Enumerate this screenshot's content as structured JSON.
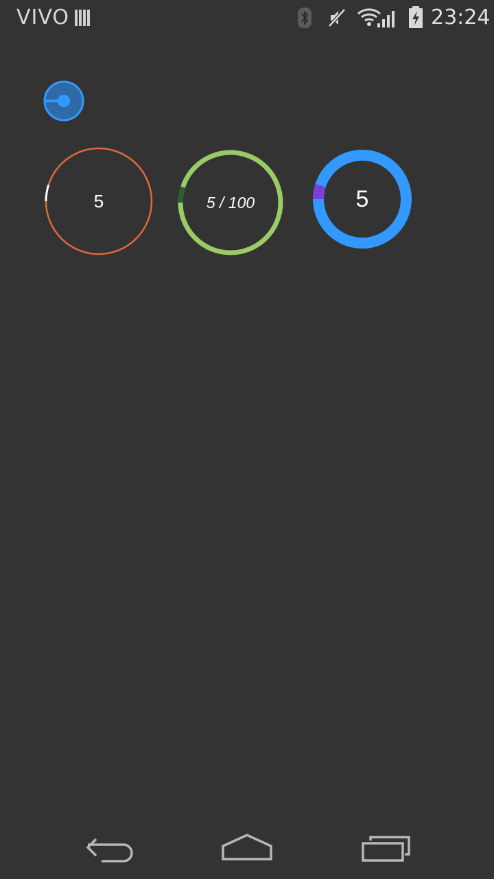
{
  "status_bar": {
    "carrier": "VIVO",
    "time": "23:24",
    "icons": [
      "signal-bars-icon",
      "bluetooth-icon",
      "mute-icon",
      "wifi-icon",
      "cell-signal-icon",
      "battery-charging-icon"
    ]
  },
  "colors": {
    "background": "#333333",
    "ring1_track": "#e0693a",
    "ring1_progress": "#ffffff",
    "ring2_track": "#99cc66",
    "ring2_progress": "#2e5e33",
    "ring3_track": "#3399ff",
    "ring3_progress": "#7a3fd6",
    "knob": "#3399ff"
  },
  "progress_rings": [
    {
      "label": "5",
      "value": 5,
      "max": 100
    },
    {
      "label": "5 / 100",
      "value": 5,
      "max": 100
    },
    {
      "label": "5",
      "value": 5,
      "max": 100
    }
  ],
  "nav_bar": {
    "buttons": [
      "back-icon",
      "home-icon",
      "recent-apps-icon"
    ]
  }
}
